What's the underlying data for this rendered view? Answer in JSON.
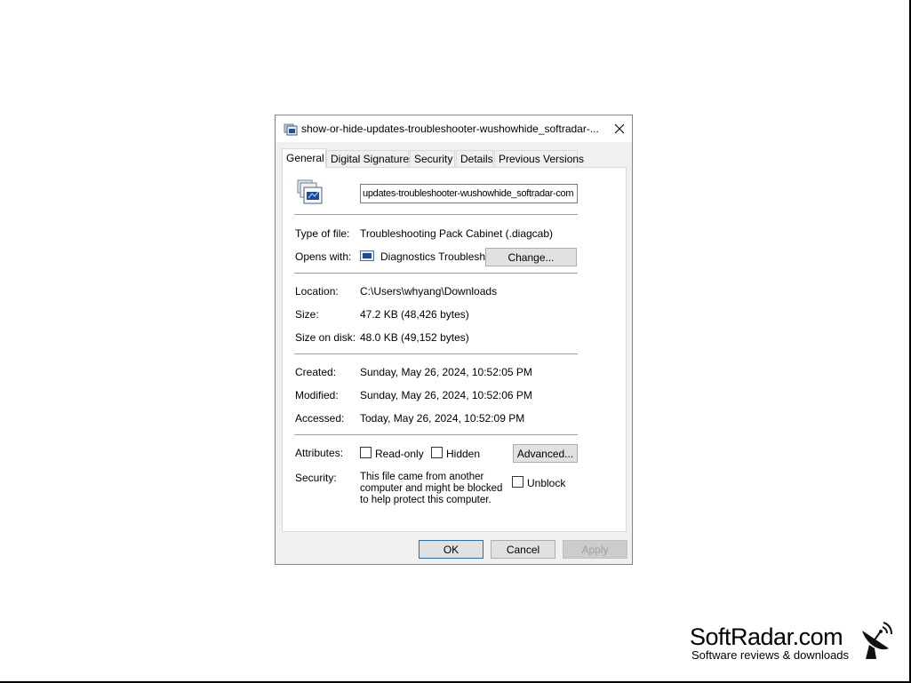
{
  "dialog": {
    "title": "show-or-hide-updates-troubleshooter-wushowhide_softradar-...",
    "tabs": [
      "General",
      "Digital Signatures",
      "Security",
      "Details",
      "Previous Versions"
    ],
    "active_tab": "General",
    "file_name": "updates-troubleshooter-wushowhide_softradar-com",
    "fields": {
      "type_label": "Type of file:",
      "type_value": "Troubleshooting Pack Cabinet (.diagcab)",
      "opens_label": "Opens with:",
      "opens_value": "Diagnostics Troublesho",
      "change_button": "Change...",
      "location_label": "Location:",
      "location_value": "C:\\Users\\whyang\\Downloads",
      "size_label": "Size:",
      "size_value": "47.2 KB (48,426 bytes)",
      "size_disk_label": "Size on disk:",
      "size_disk_value": "48.0 KB (49,152 bytes)",
      "created_label": "Created:",
      "created_value": "Sunday, May 26, 2024, 10:52:05 PM",
      "modified_label": "Modified:",
      "modified_value": "Sunday, May 26, 2024, 10:52:06 PM",
      "accessed_label": "Accessed:",
      "accessed_value": "Today, May 26, 2024, 10:52:09 PM",
      "attributes_label": "Attributes:",
      "readonly_label": "Read-only",
      "hidden_label": "Hidden",
      "advanced_button": "Advanced...",
      "security_label": "Security:",
      "security_text": "This file came from another computer and might be blocked to help protect this computer.",
      "unblock_label": "Unblock"
    },
    "buttons": {
      "ok": "OK",
      "cancel": "Cancel",
      "apply": "Apply"
    },
    "icons": {
      "title": "diagcab-file-icon",
      "file": "diagcab-file-icon",
      "opens_with": "diagnostics-app-icon",
      "close": "close-icon"
    }
  },
  "branding": {
    "name": "SoftRadar.com",
    "tagline": "Software reviews & downloads",
    "icon": "satellite-dish-icon"
  }
}
